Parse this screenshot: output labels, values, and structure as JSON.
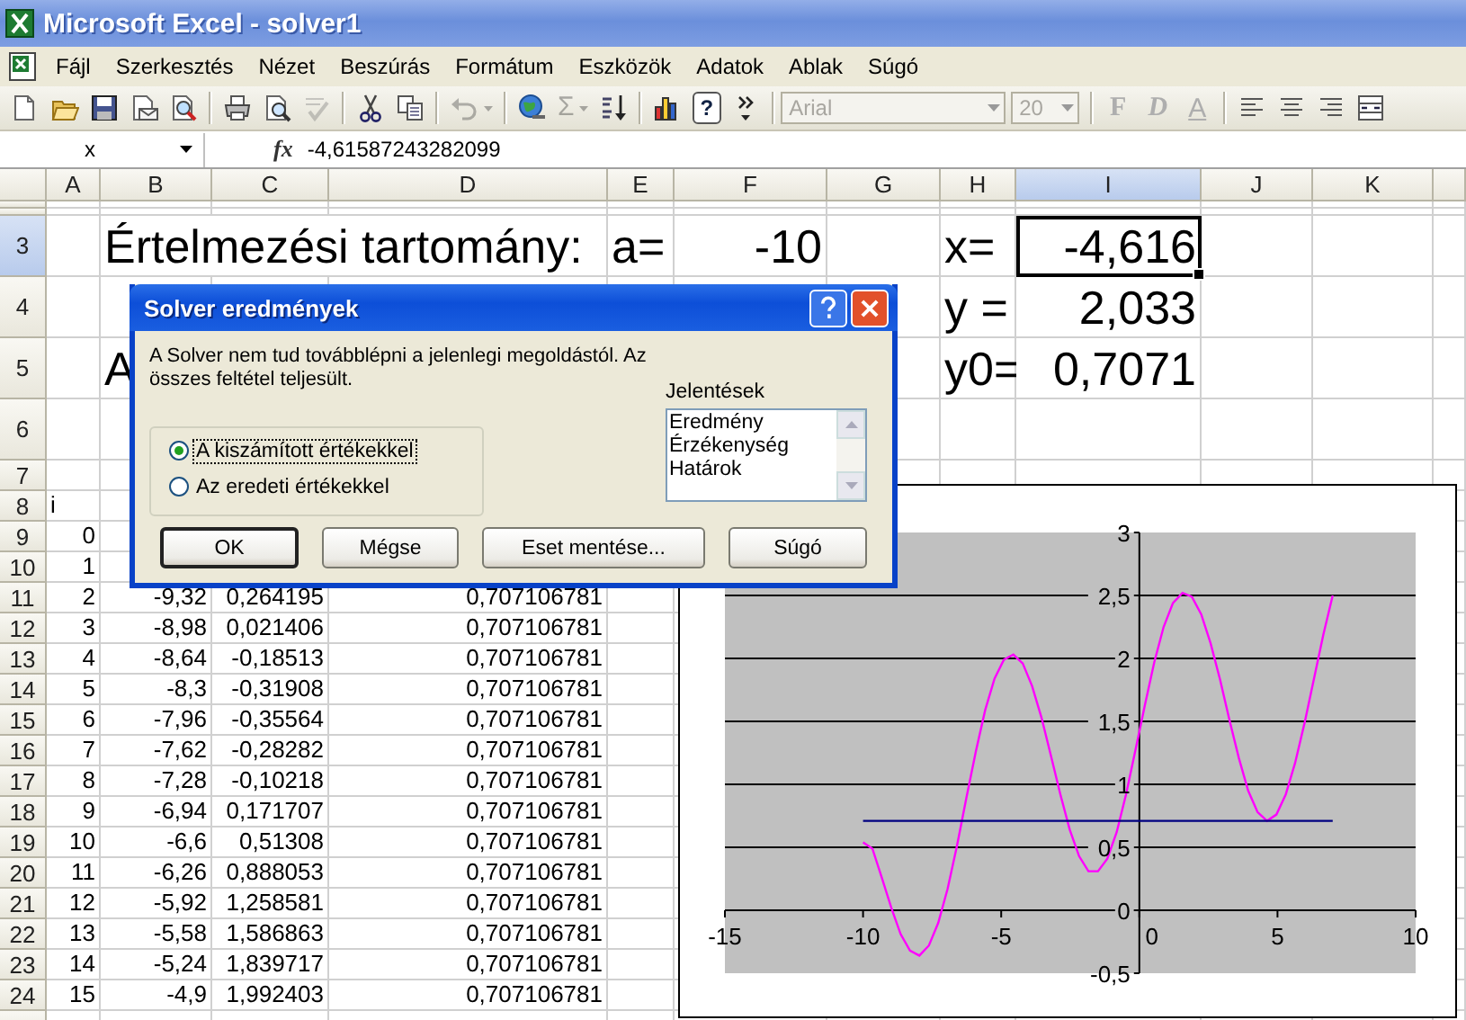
{
  "window": {
    "title": "Microsoft Excel - solver1"
  },
  "menu": [
    "Fájl",
    "Szerkesztés",
    "Nézet",
    "Beszúrás",
    "Formátum",
    "Eszközök",
    "Adatok",
    "Ablak",
    "Súgó"
  ],
  "toolbar": {
    "groups": [
      [
        {
          "kind": "new",
          "disabled": false,
          "menu": false
        },
        {
          "kind": "open",
          "disabled": false,
          "menu": false
        },
        {
          "kind": "save",
          "disabled": false,
          "menu": false
        },
        {
          "kind": "mail",
          "disabled": false,
          "menu": false
        },
        {
          "kind": "research",
          "disabled": false,
          "menu": false
        }
      ],
      [
        {
          "kind": "print",
          "disabled": false,
          "menu": false
        },
        {
          "kind": "preview",
          "disabled": false,
          "menu": false
        },
        {
          "kind": "spelling",
          "disabled": true,
          "menu": false
        }
      ],
      [
        {
          "kind": "cut",
          "disabled": false,
          "menu": false
        },
        {
          "kind": "copy",
          "disabled": false,
          "menu": false
        }
      ],
      [
        {
          "kind": "undo",
          "disabled": true,
          "menu": true
        }
      ],
      [
        {
          "kind": "hyperlink",
          "disabled": false,
          "menu": false
        },
        {
          "kind": "autosum",
          "symbol": "Σ",
          "disabled": true,
          "menu": true
        },
        {
          "kind": "sort",
          "disabled": false,
          "menu": false
        }
      ],
      [
        {
          "kind": "chart",
          "disabled": false,
          "menu": false
        },
        {
          "kind": "help",
          "symbol": "?",
          "disabled": false,
          "menu": false
        },
        {
          "kind": "more",
          "disabled": false,
          "menu": false
        }
      ]
    ],
    "font": {
      "value": "Arial",
      "disabled": true
    },
    "size": {
      "value": "20",
      "disabled": true
    },
    "format_buttons": [
      {
        "kind": "bold",
        "label": "F",
        "disabled": true
      },
      {
        "kind": "italic",
        "label": "D",
        "disabled": true
      },
      {
        "kind": "underline",
        "label": "A",
        "disabled": true
      }
    ],
    "align_tools": [
      {
        "kind": "alignleft",
        "disabled": false,
        "menu": false
      },
      {
        "kind": "center",
        "disabled": false,
        "menu": false
      },
      {
        "kind": "alignright",
        "disabled": false,
        "menu": false
      },
      {
        "kind": "merge",
        "disabled": false,
        "menu": false
      }
    ]
  },
  "formula_bar": {
    "name_box": "x",
    "function_label": "fx",
    "formula": "-4,61587243282099"
  },
  "sheet": {
    "columns": [
      {
        "label": "A",
        "selected": false
      },
      {
        "label": "B",
        "selected": false
      },
      {
        "label": "C",
        "selected": false
      },
      {
        "label": "D",
        "selected": false
      },
      {
        "label": "E",
        "selected": false
      },
      {
        "label": "F",
        "selected": false
      },
      {
        "label": "G",
        "selected": false
      },
      {
        "label": "H",
        "selected": false
      },
      {
        "label": "I",
        "selected": true
      },
      {
        "label": "J",
        "selected": false
      },
      {
        "label": "K",
        "selected": false
      }
    ],
    "rows": [
      {
        "label": "3",
        "kind": "big",
        "selected": true,
        "cells": [
          {
            "text": "",
            "kind": "empty"
          },
          {
            "text": "Értelmezési tartomány:",
            "kind": "text"
          },
          {
            "text": "",
            "kind": "empty"
          },
          {
            "text": "",
            "kind": "empty"
          },
          {
            "text": "a=",
            "kind": "text"
          },
          {
            "text": "-10",
            "kind": "number"
          },
          {
            "text": "",
            "kind": "empty"
          },
          {
            "text": "x=",
            "kind": "text"
          },
          {
            "text": "-4,616",
            "kind": "number"
          }
        ]
      },
      {
        "label": "4",
        "kind": "big",
        "selected": false,
        "cells": [
          {
            "text": "",
            "kind": "empty"
          },
          {
            "text": "",
            "kind": "empty"
          },
          {
            "text": "",
            "kind": "empty"
          },
          {
            "text": "",
            "kind": "empty"
          },
          {
            "text": "",
            "kind": "empty"
          },
          {
            "text": "",
            "kind": "empty"
          },
          {
            "text": "",
            "kind": "empty"
          },
          {
            "text": "y =",
            "kind": "text"
          },
          {
            "text": "2,033",
            "kind": "number"
          }
        ]
      },
      {
        "label": "5",
        "kind": "big",
        "selected": false,
        "cells": [
          {
            "text": "",
            "kind": "empty"
          },
          {
            "text": "A",
            "kind": "text"
          },
          {
            "text": "",
            "kind": "empty"
          },
          {
            "text": "",
            "kind": "empty"
          },
          {
            "text": "",
            "kind": "empty"
          },
          {
            "text": "",
            "kind": "empty"
          },
          {
            "text": "",
            "kind": "empty"
          },
          {
            "text": "y0=",
            "kind": "text"
          },
          {
            "text": "0,7071",
            "kind": "number"
          }
        ]
      },
      {
        "label": "6",
        "kind": "big",
        "selected": false,
        "cells": []
      },
      {
        "label": "7",
        "kind": "small",
        "selected": false,
        "cells": []
      },
      {
        "label": "8",
        "kind": "small",
        "selected": false,
        "cells": [
          {
            "text": "i",
            "kind": "text"
          }
        ]
      },
      {
        "label": "9",
        "kind": "small",
        "selected": false,
        "cells": [
          {
            "text": "0",
            "kind": "number"
          }
        ]
      },
      {
        "label": "10",
        "kind": "small",
        "selected": false,
        "cells": [
          {
            "text": "1",
            "kind": "number"
          }
        ]
      },
      {
        "label": "11",
        "kind": "small",
        "selected": false,
        "cells": [
          {
            "text": "2",
            "kind": "number"
          },
          {
            "text": "-9,32",
            "kind": "number"
          },
          {
            "text": "0,264195",
            "kind": "number"
          },
          {
            "text": "0,707106781",
            "kind": "number"
          }
        ]
      },
      {
        "label": "12",
        "kind": "small",
        "selected": false,
        "cells": [
          {
            "text": "3",
            "kind": "number"
          },
          {
            "text": "-8,98",
            "kind": "number"
          },
          {
            "text": "0,021406",
            "kind": "number"
          },
          {
            "text": "0,707106781",
            "kind": "number"
          }
        ]
      },
      {
        "label": "13",
        "kind": "small",
        "selected": false,
        "cells": [
          {
            "text": "4",
            "kind": "number"
          },
          {
            "text": "-8,64",
            "kind": "number"
          },
          {
            "text": "-0,18513",
            "kind": "number"
          },
          {
            "text": "0,707106781",
            "kind": "number"
          }
        ]
      },
      {
        "label": "14",
        "kind": "small",
        "selected": false,
        "cells": [
          {
            "text": "5",
            "kind": "number"
          },
          {
            "text": "-8,3",
            "kind": "number"
          },
          {
            "text": "-0,31908",
            "kind": "number"
          },
          {
            "text": "0,707106781",
            "kind": "number"
          }
        ]
      },
      {
        "label": "15",
        "kind": "small",
        "selected": false,
        "cells": [
          {
            "text": "6",
            "kind": "number"
          },
          {
            "text": "-7,96",
            "kind": "number"
          },
          {
            "text": "-0,35564",
            "kind": "number"
          },
          {
            "text": "0,707106781",
            "kind": "number"
          }
        ]
      },
      {
        "label": "16",
        "kind": "small",
        "selected": false,
        "cells": [
          {
            "text": "7",
            "kind": "number"
          },
          {
            "text": "-7,62",
            "kind": "number"
          },
          {
            "text": "-0,28282",
            "kind": "number"
          },
          {
            "text": "0,707106781",
            "kind": "number"
          }
        ]
      },
      {
        "label": "17",
        "kind": "small",
        "selected": false,
        "cells": [
          {
            "text": "8",
            "kind": "number"
          },
          {
            "text": "-7,28",
            "kind": "number"
          },
          {
            "text": "-0,10218",
            "kind": "number"
          },
          {
            "text": "0,707106781",
            "kind": "number"
          }
        ]
      },
      {
        "label": "18",
        "kind": "small",
        "selected": false,
        "cells": [
          {
            "text": "9",
            "kind": "number"
          },
          {
            "text": "-6,94",
            "kind": "number"
          },
          {
            "text": "0,171707",
            "kind": "number"
          },
          {
            "text": "0,707106781",
            "kind": "number"
          }
        ]
      },
      {
        "label": "19",
        "kind": "small",
        "selected": false,
        "cells": [
          {
            "text": "10",
            "kind": "number"
          },
          {
            "text": "-6,6",
            "kind": "number"
          },
          {
            "text": "0,51308",
            "kind": "number"
          },
          {
            "text": "0,707106781",
            "kind": "number"
          }
        ]
      },
      {
        "label": "20",
        "kind": "small",
        "selected": false,
        "cells": [
          {
            "text": "11",
            "kind": "number"
          },
          {
            "text": "-6,26",
            "kind": "number"
          },
          {
            "text": "0,888053",
            "kind": "number"
          },
          {
            "text": "0,707106781",
            "kind": "number"
          }
        ]
      },
      {
        "label": "21",
        "kind": "small",
        "selected": false,
        "cells": [
          {
            "text": "12",
            "kind": "number"
          },
          {
            "text": "-5,92",
            "kind": "number"
          },
          {
            "text": "1,258581",
            "kind": "number"
          },
          {
            "text": "0,707106781",
            "kind": "number"
          }
        ]
      },
      {
        "label": "22",
        "kind": "small",
        "selected": false,
        "cells": [
          {
            "text": "13",
            "kind": "number"
          },
          {
            "text": "-5,58",
            "kind": "number"
          },
          {
            "text": "1,586863",
            "kind": "number"
          },
          {
            "text": "0,707106781",
            "kind": "number"
          }
        ]
      },
      {
        "label": "23",
        "kind": "small",
        "selected": false,
        "cells": [
          {
            "text": "14",
            "kind": "number"
          },
          {
            "text": "-5,24",
            "kind": "number"
          },
          {
            "text": "1,839717",
            "kind": "number"
          },
          {
            "text": "0,707106781",
            "kind": "number"
          }
        ]
      },
      {
        "label": "24",
        "kind": "small",
        "selected": false,
        "cells": [
          {
            "text": "15",
            "kind": "number"
          },
          {
            "text": "-4,9",
            "kind": "number"
          },
          {
            "text": "1,992403",
            "kind": "number"
          },
          {
            "text": "0,707106781",
            "kind": "number"
          }
        ]
      }
    ]
  },
  "chart": {
    "chart_data": {
      "type": "line",
      "grid": true,
      "x": [
        -10,
        -9.66,
        -9.32,
        -8.98,
        -8.64,
        -8.3,
        -7.96,
        -7.62,
        -7.28,
        -6.94,
        -6.6,
        -6.26,
        -5.92,
        -5.58,
        -5.24,
        -4.9,
        -4.56,
        -4.22,
        -3.88,
        -3.54,
        -3.2,
        -2.86,
        -2.52,
        -2.18,
        -1.84,
        -1.5,
        -1.16,
        -0.82,
        -0.48,
        -0.14,
        0.2,
        0.54,
        0.88,
        1.22,
        1.56,
        1.9,
        2.24,
        2.58,
        2.92,
        3.26,
        3.6,
        3.94,
        4.28,
        4.62,
        4.96,
        5.3,
        5.64,
        5.98,
        6.32,
        6.66,
        7
      ],
      "series": [
        {
          "color": "#ff00ff",
          "values": [
            0.54,
            0.49,
            0.26,
            0.02,
            -0.19,
            -0.32,
            -0.36,
            -0.28,
            -0.1,
            0.17,
            0.51,
            0.89,
            1.26,
            1.59,
            1.84,
            1.99,
            2.03,
            1.96,
            1.78,
            1.53,
            1.23,
            0.92,
            0.64,
            0.43,
            0.31,
            0.31,
            0.41,
            0.62,
            0.92,
            1.27,
            1.63,
            1.97,
            2.25,
            2.44,
            2.52,
            2.49,
            2.35,
            2.12,
            1.83,
            1.51,
            1.21,
            0.95,
            0.78,
            0.71,
            0.76,
            0.92,
            1.17,
            1.49,
            1.84,
            2.19,
            2.5
          ]
        },
        {
          "color": "#000080",
          "values": [
            0.71,
            0.71,
            0.71,
            0.71,
            0.71,
            0.71,
            0.71,
            0.71,
            0.71,
            0.71,
            0.71,
            0.71,
            0.71,
            0.71,
            0.71,
            0.71,
            0.71,
            0.71,
            0.71,
            0.71,
            0.71,
            0.71,
            0.71,
            0.71,
            0.71,
            0.71,
            0.71,
            0.71,
            0.71,
            0.71,
            0.71,
            0.71,
            0.71,
            0.71,
            0.71,
            0.71,
            0.71,
            0.71,
            0.71,
            0.71,
            0.71,
            0.71,
            0.71,
            0.71,
            0.71,
            0.71,
            0.71,
            0.71,
            0.71,
            0.71,
            0.71
          ]
        }
      ],
      "xlim": [
        -15,
        10
      ],
      "ylim": [
        -0.5,
        3
      ],
      "xticks": [
        -15,
        -10,
        -5,
        0,
        5,
        10
      ],
      "yticks": [
        {
          "value": -0.5,
          "label": "-0,5"
        },
        {
          "value": 0,
          "label": "0"
        },
        {
          "value": 0.5,
          "label": "0,5"
        },
        {
          "value": 1,
          "label": "1"
        },
        {
          "value": 1.5,
          "label": "1,5"
        },
        {
          "value": 2,
          "label": "2"
        },
        {
          "value": 2.5,
          "label": "2,5"
        },
        {
          "value": 3,
          "label": "3"
        }
      ]
    }
  },
  "dialog": {
    "title": "Solver eredmények",
    "message": "A Solver nem tud továbblépni a jelenlegi megoldástól.  Az összes feltétel teljesült.",
    "options": [
      {
        "label": "A kiszámított értékekkel",
        "selected": true
      },
      {
        "label": "Az eredeti értékekkel",
        "selected": false
      }
    ],
    "reports_label": "Jelentések",
    "reports": [
      "Eredmény",
      "Érzékenység",
      "Határok"
    ],
    "buttons": [
      {
        "label": "OK",
        "default": true
      },
      {
        "label": "Mégse",
        "default": false
      },
      {
        "label": "Eset mentése...",
        "default": false
      },
      {
        "label": "Súgó",
        "default": false
      }
    ]
  }
}
